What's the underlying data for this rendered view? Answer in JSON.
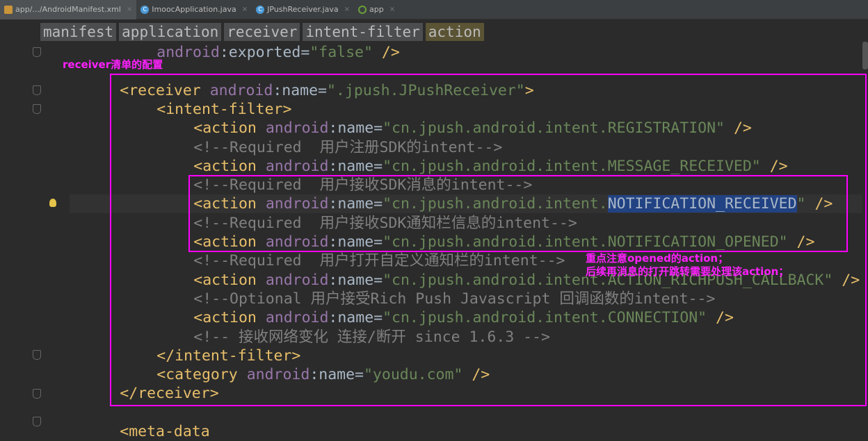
{
  "tabs": [
    {
      "label": "app/.../AndroidManifest.xml",
      "icon": "xml-file-icon",
      "active": true
    },
    {
      "label": "ImoocApplication.java",
      "icon": "class-icon"
    },
    {
      "label": "JPushReceiver.java",
      "icon": "class-icon"
    },
    {
      "label": "app",
      "icon": "module-icon"
    }
  ],
  "breadcrumbs": [
    "manifest",
    "application",
    "receiver",
    "intent-filter",
    "action"
  ],
  "code_lines": [
    {
      "indent": 17,
      "tokens": [
        [
          "attr",
          "android"
        ],
        [
          "txt",
          ":exported="
        ],
        [
          "val",
          "\"false\""
        ],
        [
          "txt",
          " "
        ],
        [
          "tag",
          "/>"
        ]
      ]
    },
    {
      "indent": 13,
      "tokens": [
        [
          "tag",
          "<receiver"
        ],
        [
          "txt",
          " "
        ],
        [
          "attr",
          "android"
        ],
        [
          "txt",
          ":name="
        ],
        [
          "val",
          "\".jpush.JPushReceiver\""
        ],
        [
          "tag",
          ">"
        ]
      ],
      "row": 2
    },
    {
      "indent": 17,
      "tokens": [
        [
          "tag",
          "<intent-filter>"
        ]
      ],
      "row": 3
    },
    {
      "indent": 21,
      "tokens": [
        [
          "tag",
          "<action"
        ],
        [
          "txt",
          " "
        ],
        [
          "attr",
          "android"
        ],
        [
          "txt",
          ":name="
        ],
        [
          "val",
          "\"cn.jpush.android.intent.REGISTRATION\""
        ],
        [
          "txt",
          " "
        ],
        [
          "tag",
          "/>"
        ]
      ],
      "row": 4
    },
    {
      "indent": 21,
      "tokens": [
        [
          "com",
          "<!--Required  用户注册SDK的intent-->"
        ]
      ],
      "row": 5
    },
    {
      "indent": 21,
      "tokens": [
        [
          "tag",
          "<action"
        ],
        [
          "txt",
          " "
        ],
        [
          "attr",
          "android"
        ],
        [
          "txt",
          ":name="
        ],
        [
          "val",
          "\"cn.jpush.android.intent.MESSAGE_RECEIVED\""
        ],
        [
          "txt",
          " "
        ],
        [
          "tag",
          "/>"
        ]
      ],
      "row": 6
    },
    {
      "indent": 21,
      "tokens": [
        [
          "com",
          "<!--Required  用户接收SDK消息的intent-->"
        ]
      ],
      "row": 7
    },
    {
      "indent": 21,
      "tokens": [
        [
          "tag",
          "<action"
        ],
        [
          "txt",
          " "
        ],
        [
          "attr",
          "android"
        ],
        [
          "txt",
          ":name="
        ],
        [
          "val",
          "\"cn.jpush.android.intent."
        ],
        [
          "sel",
          "NOTIFICATION_RECEIVED"
        ],
        [
          "val",
          "\""
        ],
        [
          "txt",
          " "
        ],
        [
          "tag",
          "/>"
        ]
      ],
      "row": 8,
      "current": true
    },
    {
      "indent": 21,
      "tokens": [
        [
          "com",
          "<!--Required  用户接收SDK通知栏信息的intent-->"
        ]
      ],
      "row": 9
    },
    {
      "indent": 21,
      "tokens": [
        [
          "tag",
          "<action"
        ],
        [
          "txt",
          " "
        ],
        [
          "attr",
          "android"
        ],
        [
          "txt",
          ":name="
        ],
        [
          "val",
          "\"cn.jpush.android.intent.NOTIFICATION_OPENED\""
        ],
        [
          "txt",
          " "
        ],
        [
          "tag",
          "/>"
        ]
      ],
      "row": 10
    },
    {
      "indent": 21,
      "tokens": [
        [
          "com",
          "<!--Required  用户打开自定义通知栏的intent-->"
        ]
      ],
      "row": 11
    },
    {
      "indent": 21,
      "tokens": [
        [
          "tag",
          "<action"
        ],
        [
          "txt",
          " "
        ],
        [
          "attr",
          "android"
        ],
        [
          "txt",
          ":name="
        ],
        [
          "val",
          "\"cn.jpush.android.intent.ACTION_RICHPUSH_CALLBACK\""
        ],
        [
          "txt",
          " "
        ],
        [
          "tag",
          "/>"
        ]
      ],
      "row": 12
    },
    {
      "indent": 21,
      "tokens": [
        [
          "com",
          "<!--Optional 用户接受Rich Push Javascript 回调函数的intent-->"
        ]
      ],
      "row": 13
    },
    {
      "indent": 21,
      "tokens": [
        [
          "tag",
          "<action"
        ],
        [
          "txt",
          " "
        ],
        [
          "attr",
          "android"
        ],
        [
          "txt",
          ":name="
        ],
        [
          "val",
          "\"cn.jpush.android.intent.CONNECTION\""
        ],
        [
          "txt",
          " "
        ],
        [
          "tag",
          "/>"
        ]
      ],
      "row": 14
    },
    {
      "indent": 21,
      "tokens": [
        [
          "com",
          "<!-- 接收网络变化 连接/断开 since 1.6.3 -->"
        ]
      ],
      "row": 15
    },
    {
      "indent": 17,
      "tokens": [
        [
          "tag",
          "</intent-filter>"
        ]
      ],
      "row": 16
    },
    {
      "indent": 17,
      "tokens": [
        [
          "tag",
          "<category"
        ],
        [
          "txt",
          " "
        ],
        [
          "attr",
          "android"
        ],
        [
          "txt",
          ":name="
        ],
        [
          "val",
          "\"youdu.com\""
        ],
        [
          "txt",
          " "
        ],
        [
          "tag",
          "/>"
        ]
      ],
      "row": 17
    },
    {
      "indent": 13,
      "tokens": [
        [
          "tag",
          "</receiver>"
        ]
      ],
      "row": 18
    },
    {
      "indent": 13,
      "tokens": [
        [
          "tag",
          "<meta-data"
        ]
      ],
      "row": 20
    }
  ],
  "annotations": {
    "receiver_note": "receiver清单的配置",
    "opened_note_1": "重点注意opened的action；",
    "opened_note_2": "后续再消息的打开跳转需要处理该action；"
  },
  "colors": {
    "annotation": "#ff00ff",
    "tag": "#e8bf6a",
    "attr": "#9876aa",
    "value": "#6a8759",
    "comment": "#808080"
  }
}
